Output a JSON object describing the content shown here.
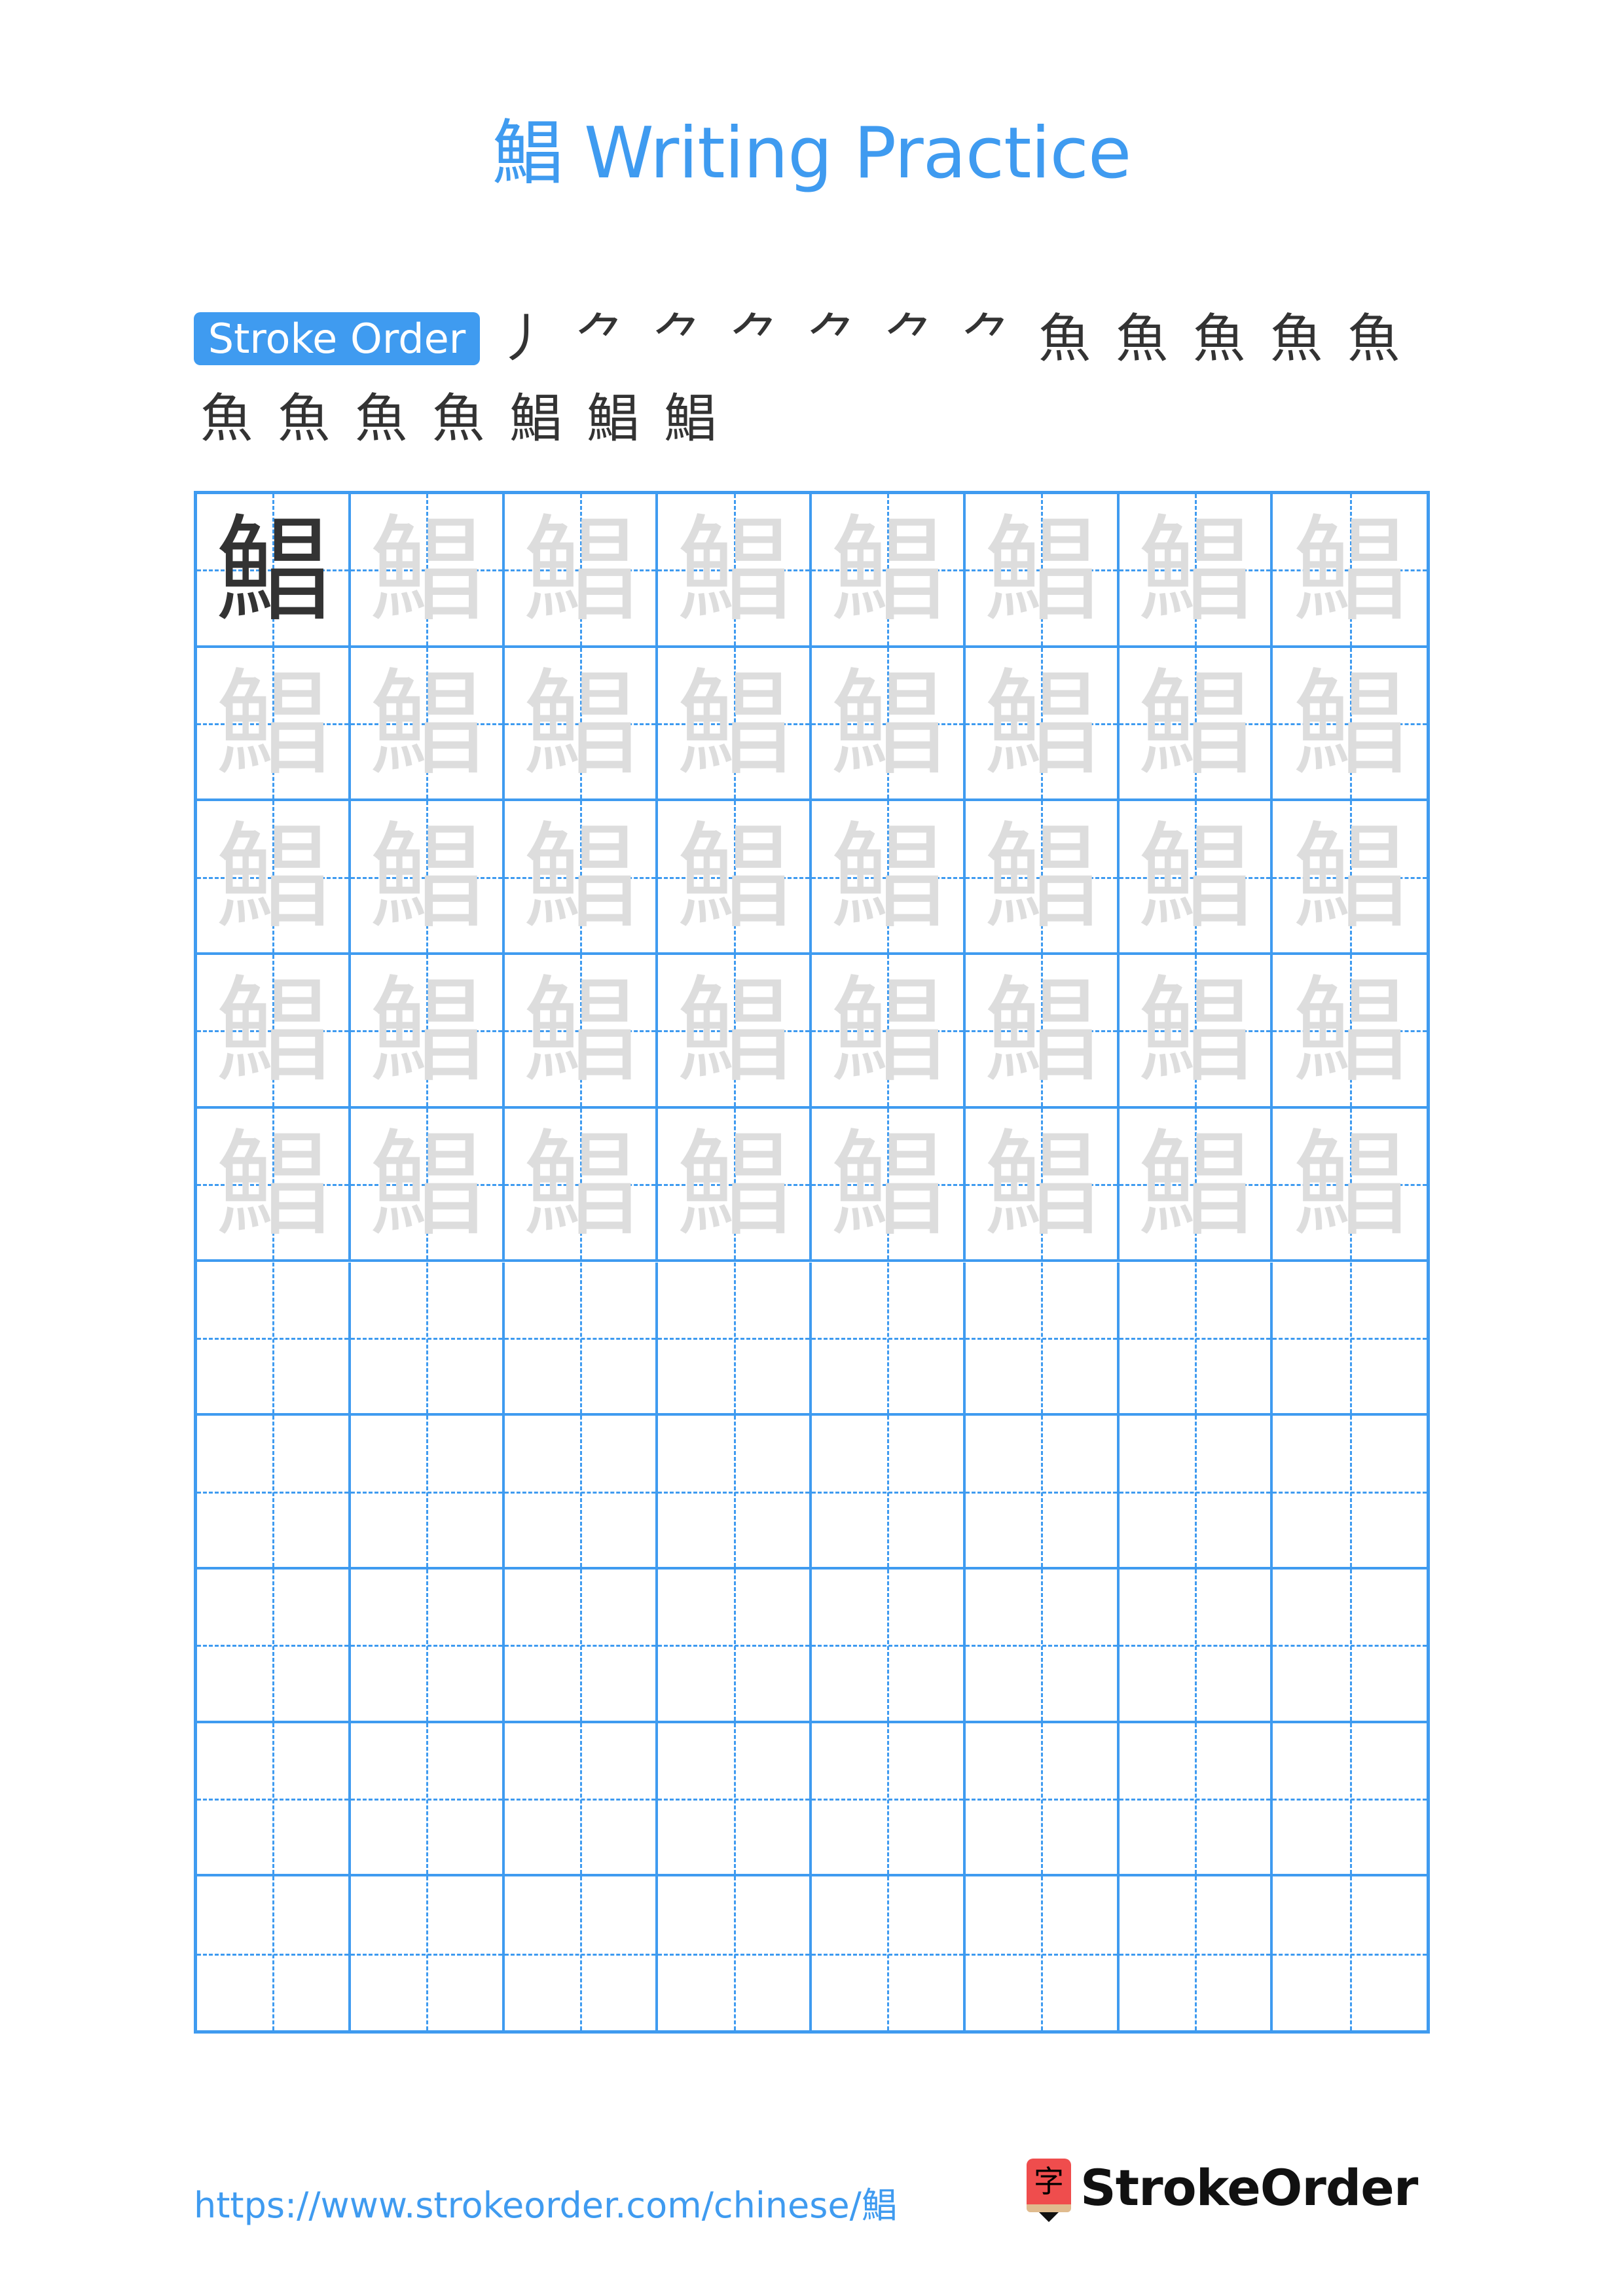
{
  "page": {
    "title": "鯧 Writing Practice",
    "character": "鯧",
    "accent_color": "#3f9bf0",
    "model_color": "#333333",
    "trace_color": "#dddddd",
    "highlight_stroke_color": "#ff0000"
  },
  "stroke_order": {
    "label": "Stroke Order",
    "total_strokes": 19,
    "steps": [
      {
        "step": 1,
        "glyph": "丿"
      },
      {
        "step": 2,
        "glyph": "⺈"
      },
      {
        "step": 3,
        "glyph": "⺈"
      },
      {
        "step": 4,
        "glyph": "⺈"
      },
      {
        "step": 5,
        "glyph": "⺈"
      },
      {
        "step": 6,
        "glyph": "⺈"
      },
      {
        "step": 7,
        "glyph": "⺈"
      },
      {
        "step": 8,
        "glyph": "魚"
      },
      {
        "step": 9,
        "glyph": "魚"
      },
      {
        "step": 10,
        "glyph": "魚"
      },
      {
        "step": 11,
        "glyph": "魚"
      },
      {
        "step": 12,
        "glyph": "魚"
      },
      {
        "step": 13,
        "glyph": "魚"
      },
      {
        "step": 14,
        "glyph": "魚"
      },
      {
        "step": 15,
        "glyph": "魚"
      },
      {
        "step": 16,
        "glyph": "魚"
      },
      {
        "step": 17,
        "glyph": "鯧"
      },
      {
        "step": 18,
        "glyph": "鯧"
      },
      {
        "step": 19,
        "glyph": "鯧"
      }
    ]
  },
  "grid": {
    "columns": 8,
    "rows": 10,
    "filled_rows": 5,
    "model_cells": 1
  },
  "footer": {
    "url": "https://www.strokeorder.com/chinese/鯧",
    "logo_glyph": "字",
    "logo_text": "StrokeOrder"
  }
}
